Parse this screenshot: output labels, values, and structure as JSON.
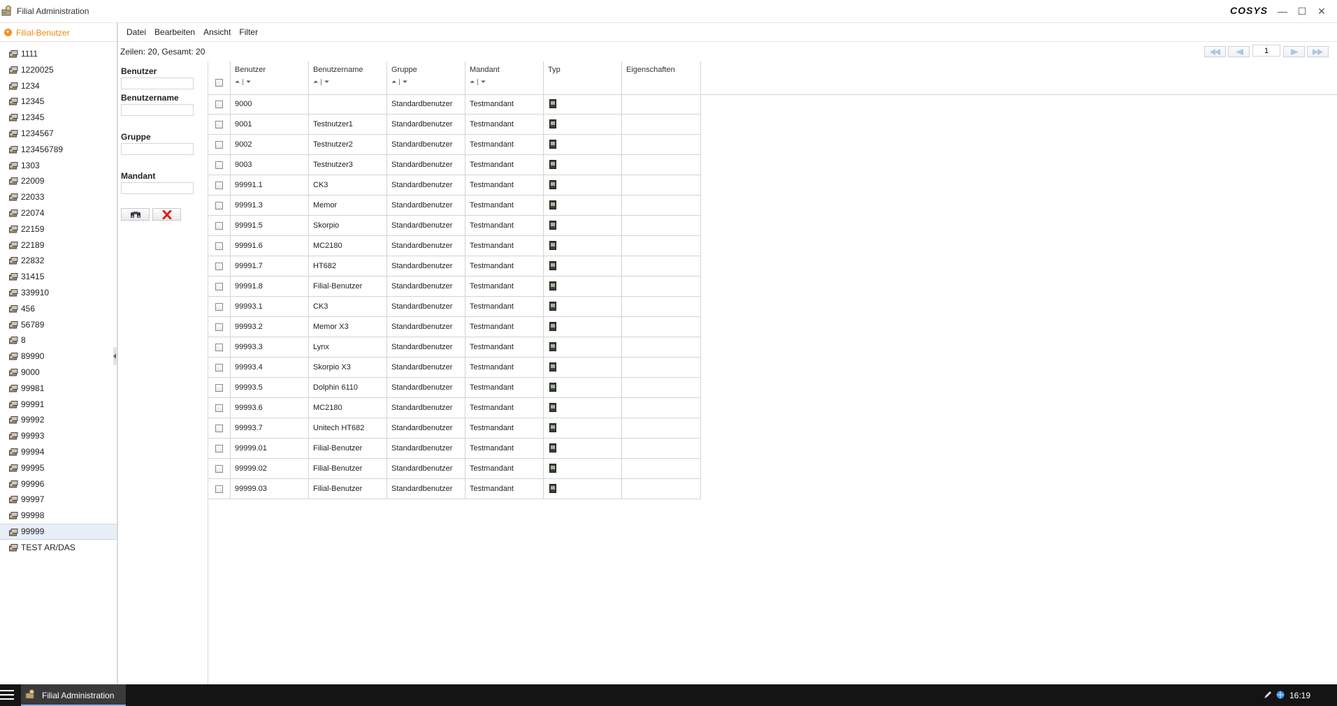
{
  "window": {
    "title": "Filial Administration",
    "brand": "COSYS",
    "minimize_symbol": "—",
    "maximize_symbol": "☐",
    "close_symbol": "✕"
  },
  "tree": {
    "header": "Filial-Benutzer",
    "items": [
      "1111",
      "1220025",
      "1234",
      "12345",
      "12345",
      "1234567",
      "123456789",
      "1303",
      "22009",
      "22033",
      "22074",
      "22159",
      "22189",
      "22832",
      "31415",
      "339910",
      "456",
      "56789",
      "8",
      "89990",
      "9000",
      "99981",
      "99991",
      "99992",
      "99993",
      "99994",
      "99995",
      "99996",
      "99997",
      "99998",
      "99999",
      "TEST AR/DAS"
    ],
    "selected": "99999"
  },
  "menu": [
    "Datei",
    "Bearbeiten",
    "Ansicht",
    "Filter"
  ],
  "pager": {
    "summary": "Zeilen: 20, Gesamt: 20",
    "page": "1"
  },
  "filter": {
    "benutzer_label": "Benutzer",
    "benutzername_label": "Benutzername",
    "gruppe_label": "Gruppe",
    "mandant_label": "Mandant",
    "search_button": "search-binoculars-icon",
    "clear_button": "clear-x-icon"
  },
  "table": {
    "columns": [
      "Benutzer",
      "Benutzername",
      "Gruppe",
      "Mandant",
      "Typ",
      "Eigenschaften"
    ],
    "sort_glyphs": "⏶ | ⏷",
    "rows": [
      [
        "9000",
        "",
        "Standardbenutzer",
        "Testmandant"
      ],
      [
        "9001",
        "Testnutzer1",
        "Standardbenutzer",
        "Testmandant"
      ],
      [
        "9002",
        "Testnutzer2",
        "Standardbenutzer",
        "Testmandant"
      ],
      [
        "9003",
        "Testnutzer3",
        "Standardbenutzer",
        "Testmandant"
      ],
      [
        "99991.1",
        "CK3",
        "Standardbenutzer",
        "Testmandant"
      ],
      [
        "99991.3",
        "Memor",
        "Standardbenutzer",
        "Testmandant"
      ],
      [
        "99991.5",
        "Skorpio",
        "Standardbenutzer",
        "Testmandant"
      ],
      [
        "99991.6",
        "MC2180",
        "Standardbenutzer",
        "Testmandant"
      ],
      [
        "99991.7",
        "HT682",
        "Standardbenutzer",
        "Testmandant"
      ],
      [
        "99991.8",
        "Filial-Benutzer",
        "Standardbenutzer",
        "Testmandant"
      ],
      [
        "99993.1",
        "CK3",
        "Standardbenutzer",
        "Testmandant"
      ],
      [
        "99993.2",
        "Memor X3",
        "Standardbenutzer",
        "Testmandant"
      ],
      [
        "99993.3",
        "Lynx",
        "Standardbenutzer",
        "Testmandant"
      ],
      [
        "99993.4",
        "Skorpio X3",
        "Standardbenutzer",
        "Testmandant"
      ],
      [
        "99993.5",
        "Dolphin 6110",
        "Standardbenutzer",
        "Testmandant"
      ],
      [
        "99993.6",
        "MC2180",
        "Standardbenutzer",
        "Testmandant"
      ],
      [
        "99993.7",
        "Unitech HT682",
        "Standardbenutzer",
        "Testmandant"
      ],
      [
        "99999.01",
        "Filial-Benutzer",
        "Standardbenutzer",
        "Testmandant"
      ],
      [
        "99999.02",
        "Filial-Benutzer",
        "Standardbenutzer",
        "Testmandant"
      ],
      [
        "99999.03",
        "Filial-Benutzer",
        "Standardbenutzer",
        "Testmandant"
      ]
    ],
    "type_icon": "mobile-device-icon"
  },
  "taskbar": {
    "app_label": "Filial Administration",
    "clock": "16:19"
  },
  "colors": {
    "accent": "#f08a10",
    "selection": "#e8eef8",
    "taskbar": "#141414"
  }
}
